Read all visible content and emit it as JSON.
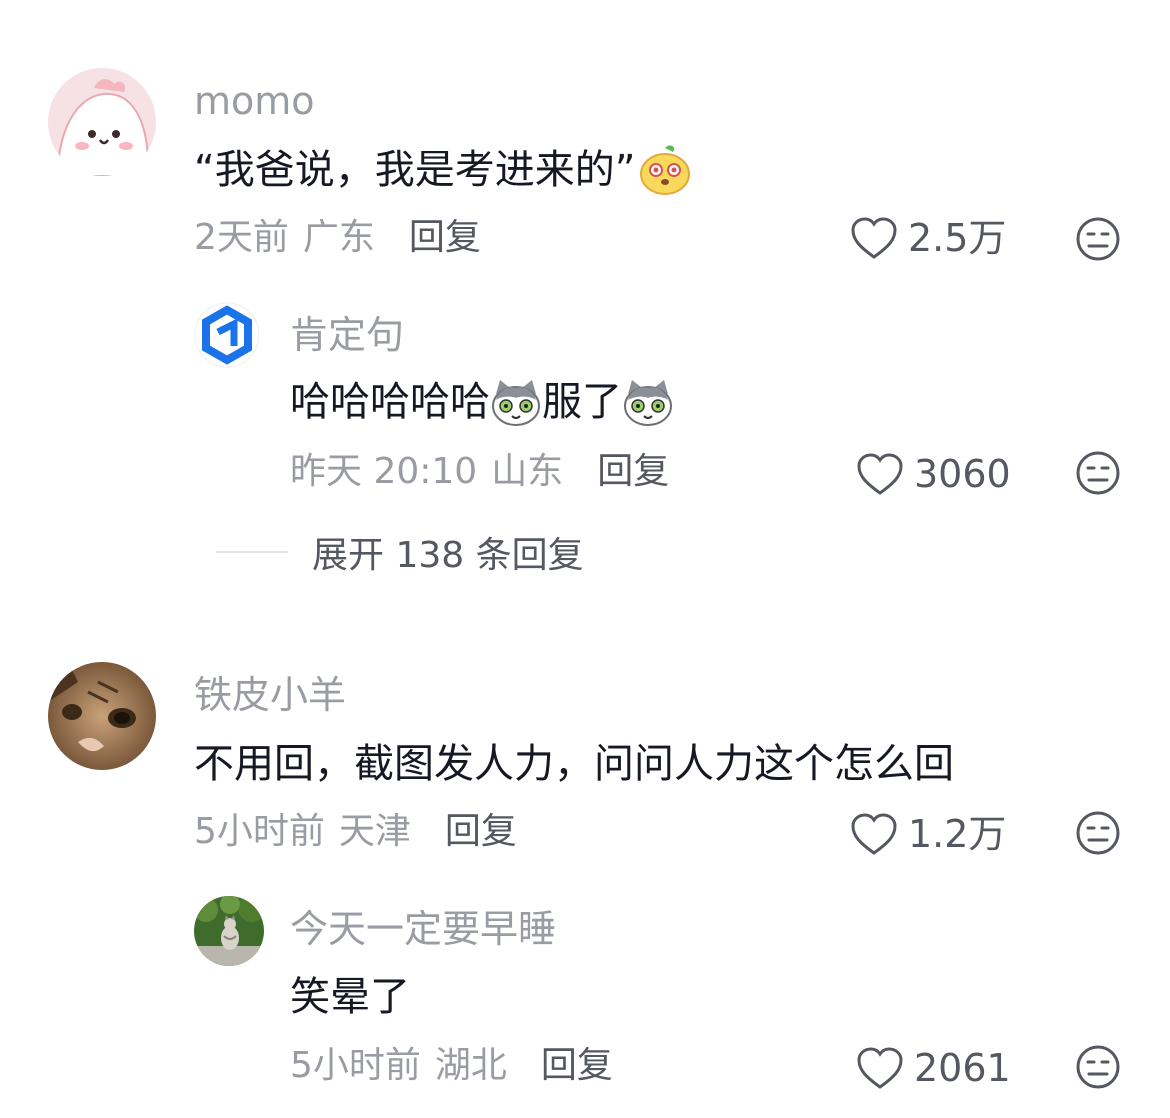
{
  "comments": [
    {
      "username": "momo",
      "text_before": "“我爸说，我是考进来的”",
      "emoji_1": "mango-face-emoji",
      "time": "2天前",
      "location": "广东",
      "reply_label": "回复",
      "likes": "2.5万",
      "reply": {
        "username": "肯定句",
        "text_part1": "哈哈哈哈哈",
        "emoji_1": "cat-face-emoji",
        "text_part2": "服了",
        "emoji_2": "cat-face-emoji",
        "time": "昨天 20:10",
        "location": "山东",
        "reply_label": "回复",
        "likes": "3060"
      },
      "expand_label": "展开 138 条回复"
    },
    {
      "username": "铁皮小羊",
      "text": "不用回，截图发人力，问问人力这个怎么回",
      "time": "5小时前",
      "location": "天津",
      "reply_label": "回复",
      "likes": "1.2万",
      "reply": {
        "username": "今天一定要早睡",
        "text": "笑晕了",
        "time": "5小时前",
        "location": "湖北",
        "reply_label": "回复",
        "likes": "2061"
      }
    }
  ],
  "icons": {
    "like": "heart-outline-icon",
    "dislike": "meh-face-icon"
  },
  "colors": {
    "text_primary": "#161823",
    "text_secondary": "#9a9ca3",
    "action": "#555861"
  }
}
